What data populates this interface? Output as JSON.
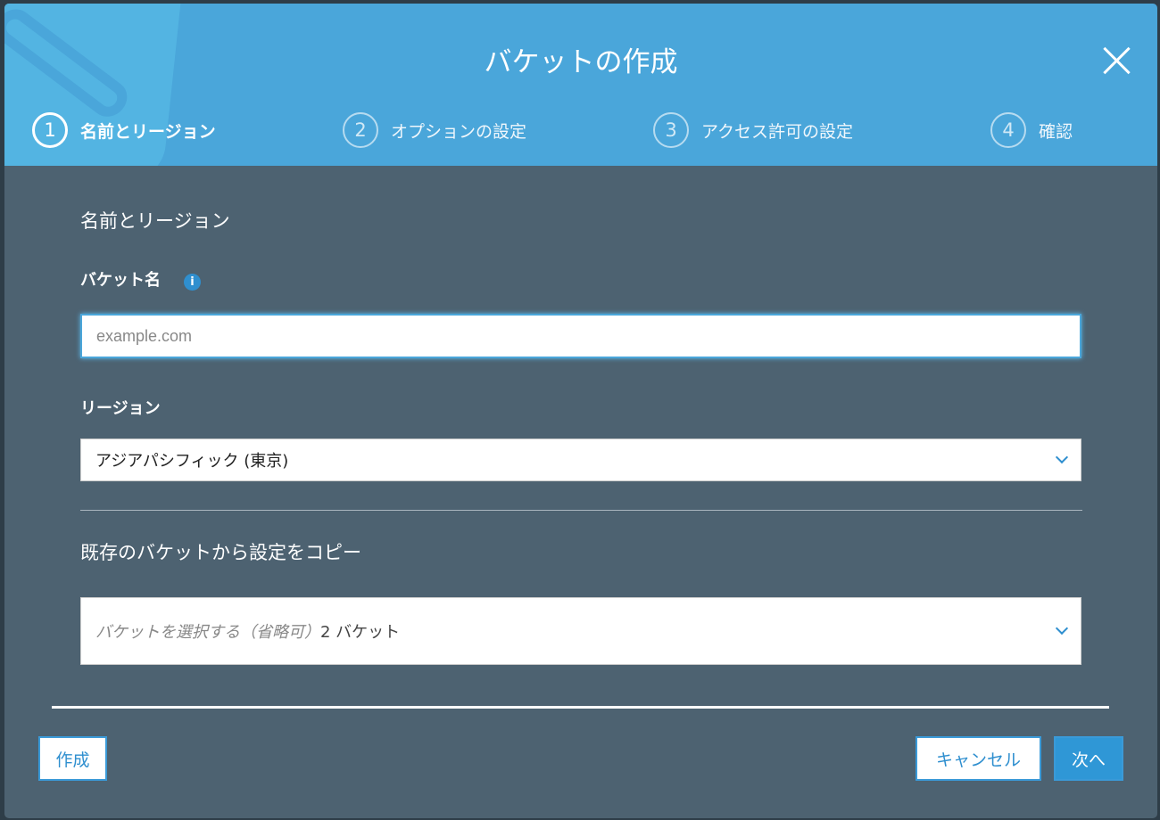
{
  "modal": {
    "title": "バケットの作成"
  },
  "steps": [
    {
      "num": "1",
      "label": "名前とリージョン"
    },
    {
      "num": "2",
      "label": "オプションの設定"
    },
    {
      "num": "3",
      "label": "アクセス許可の設定"
    },
    {
      "num": "4",
      "label": "確認"
    }
  ],
  "form": {
    "section_title": "名前とリージョン",
    "bucket_name_label": "バケット名",
    "bucket_name_placeholder": "example.com",
    "bucket_name_value": "",
    "region_label": "リージョン",
    "region_value": "アジアパシフィック (東京)",
    "copy_section_title": "既存のバケットから設定をコピー",
    "copy_placeholder": "バケットを選択する（省略可）",
    "copy_count": "2 バケット"
  },
  "footer": {
    "create": "作成",
    "cancel": "キャンセル",
    "next": "次へ"
  }
}
